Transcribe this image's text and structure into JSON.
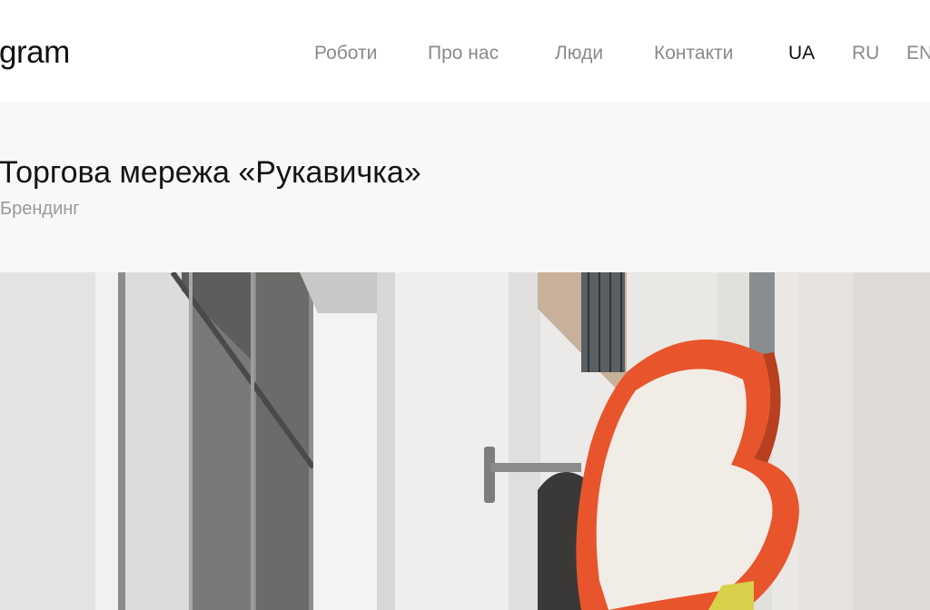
{
  "header": {
    "logo_text": "gram",
    "nav": [
      {
        "label": "Роботи"
      },
      {
        "label": "Про нас"
      },
      {
        "label": "Люди"
      },
      {
        "label": "Контакти"
      }
    ],
    "languages": [
      {
        "label": "UA",
        "active": true
      },
      {
        "label": "RU",
        "active": false
      },
      {
        "label": "EN",
        "active": false
      }
    ]
  },
  "project": {
    "title": "Торгова мережа «Рукавичка»",
    "category": "Брендинг"
  },
  "hero": {
    "image_subject": "storefront-sign-photo",
    "colors": {
      "sign_orange": "#e8552c",
      "sign_cream": "#f2ece6",
      "wall": "#ecebea",
      "window_glass": "#6f6e6c"
    }
  }
}
